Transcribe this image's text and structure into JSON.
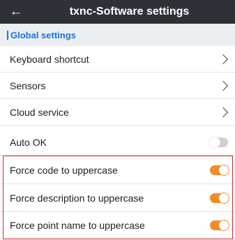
{
  "header": {
    "back_glyph": "←",
    "title": "txnc-Software settings"
  },
  "section": {
    "label": "Global settings",
    "accent_color": "#1a73e8"
  },
  "settings": [
    {
      "label": "Keyboard shortcut",
      "control": "chevron"
    },
    {
      "label": "Sensors",
      "control": "chevron"
    },
    {
      "label": "Cloud service",
      "control": "chevron"
    },
    {
      "label": "Auto OK",
      "control": "toggle",
      "state": "off"
    },
    {
      "label": "Force code to uppercase",
      "control": "toggle",
      "state": "on"
    },
    {
      "label": "Force description to uppercase",
      "control": "toggle",
      "state": "on"
    },
    {
      "label": "Force point name to uppercase",
      "control": "toggle",
      "state": "on"
    }
  ],
  "colors": {
    "topbar": "#2e3138",
    "toggle_on": "#f28b2a",
    "toggle_off": "#d0d0d0",
    "highlight_border": "#d7262c"
  }
}
